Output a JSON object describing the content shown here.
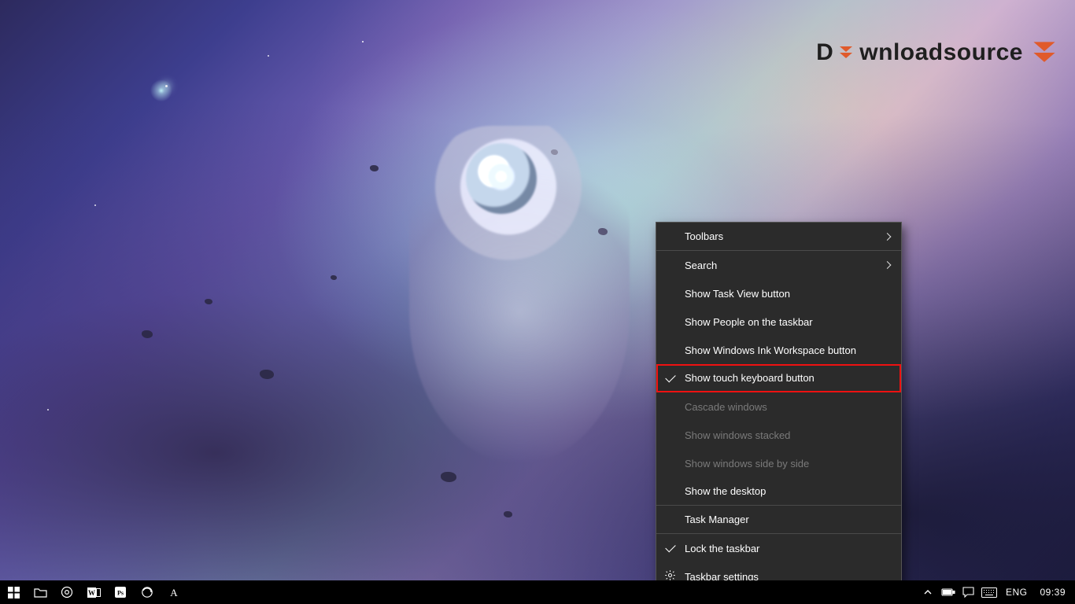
{
  "watermark": {
    "prefix": "D",
    "suffix": "wnloadsource",
    "accent_color": "#e05a2b"
  },
  "context_menu": {
    "items": [
      {
        "label": "Toolbars",
        "has_submenu": true,
        "enabled": true,
        "checked": false,
        "sep_after": true
      },
      {
        "label": "Search",
        "has_submenu": true,
        "enabled": true,
        "checked": false
      },
      {
        "label": "Show Task View button",
        "enabled": true,
        "checked": false
      },
      {
        "label": "Show People on the taskbar",
        "enabled": true,
        "checked": false
      },
      {
        "label": "Show Windows Ink Workspace button",
        "enabled": true,
        "checked": false
      },
      {
        "label": "Show touch keyboard button",
        "enabled": true,
        "checked": true,
        "highlighted": true,
        "sep_after": true
      },
      {
        "label": "Cascade windows",
        "enabled": false
      },
      {
        "label": "Show windows stacked",
        "enabled": false
      },
      {
        "label": "Show windows side by side",
        "enabled": false
      },
      {
        "label": "Show the desktop",
        "enabled": true,
        "sep_after": true
      },
      {
        "label": "Task Manager",
        "enabled": true,
        "sep_after": true
      },
      {
        "label": "Lock the taskbar",
        "enabled": true,
        "checked": true
      },
      {
        "label": "Taskbar settings",
        "enabled": true,
        "icon": "gear"
      }
    ]
  },
  "taskbar": {
    "pinned": [
      {
        "name": "start",
        "icon": "windows-icon"
      },
      {
        "name": "file-explorer",
        "icon": "folder-icon"
      },
      {
        "name": "chrome",
        "icon": "chrome-icon"
      },
      {
        "name": "word",
        "icon": "word-icon"
      },
      {
        "name": "photoshop",
        "icon": "ps-icon"
      },
      {
        "name": "firefox",
        "icon": "firefox-icon"
      },
      {
        "name": "app-a",
        "icon": "a-icon"
      }
    ],
    "tray": {
      "language": "ENG",
      "clock": "09:39"
    }
  }
}
